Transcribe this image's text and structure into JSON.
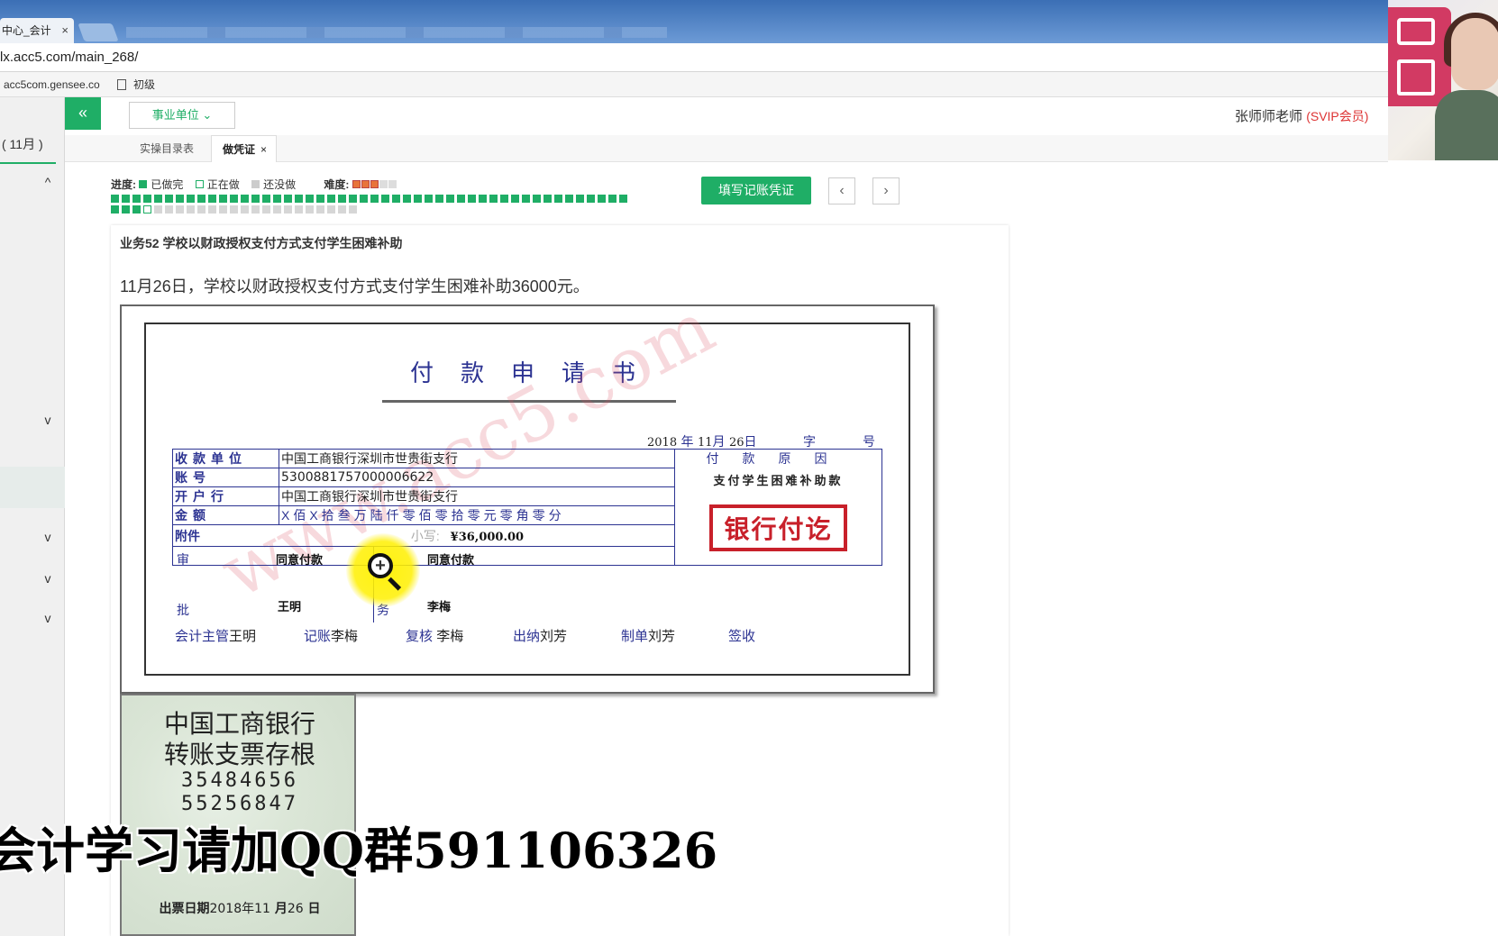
{
  "browser": {
    "tab_title": "中心_会计",
    "tab_close": "×",
    "url": "lx.acc5.com/main_268/",
    "bookmarks": [
      "acc5com.gensee.co",
      "初级"
    ]
  },
  "sidebar": {
    "month": "( 11月 )",
    "chevrons": [
      "^",
      "v",
      "v",
      "v",
      "v"
    ]
  },
  "toolbar": {
    "collapse": "«",
    "unit_select": "事业单位",
    "unit_chevron": "⌄",
    "teacher": "张师师老师",
    "svip": "(SVIP会员)"
  },
  "subtabs": {
    "catalog": "实操目录表",
    "voucher": "做凭证",
    "voucher_close": "×"
  },
  "progress": {
    "label": "进度:",
    "done": "已做完",
    "doing": "正在做",
    "todo": "还没做",
    "difficulty_label": "难度:",
    "difficulty": 3,
    "difficulty_max": 5,
    "total_items": 71,
    "completed_items": 51,
    "current_item": 52
  },
  "actions": {
    "fill_voucher": "填写记账凭证",
    "prev": "‹",
    "next": "›"
  },
  "task": {
    "title": "业务52 学校以财政授权支付方式支付学生困难补助",
    "description": "11月26日，学校以财政授权支付方式支付学生困难补助36000元。"
  },
  "form": {
    "title": "付款申请书",
    "watermark": "www.acc5.com",
    "date": {
      "year": "2018",
      "year_unit": "年",
      "month": "11",
      "month_unit": "月",
      "day": "26",
      "day_unit": "日",
      "zi": "字",
      "hao": "号"
    },
    "rows": {
      "payee_label": "收款单位",
      "payee": "中国工商银行深圳市世贵街支行",
      "account_label": "账号",
      "account": "5300881757000006622",
      "bank_label": "开户行",
      "bank": "中国工商银行深圳市世贵街支行",
      "amount_label": "金额",
      "amount_words": "X佰X拾叁万陆仟零佰零拾零元零角零分",
      "attachment_label": "附件",
      "small_label": "小写:",
      "amount_small": "¥36,000.00",
      "reason_header": "付款原因",
      "reason": "支付学生困难补助款",
      "stamp": "银行付讫",
      "approval_label_top": "审",
      "approval_label_bottom": "批",
      "approval_text_1": "同意付款",
      "approval_sign_1": "王明",
      "business_label": "务",
      "approval_text_2": "同意付款",
      "approval_sign_2": "李梅"
    },
    "footer": {
      "supervisor_label": "会计主管",
      "supervisor": "王明",
      "bookkeeper_label": "记账",
      "bookkeeper": "李梅",
      "reviewer_label": "复核",
      "reviewer": "李梅",
      "cashier_label": "出纳",
      "cashier": "刘芳",
      "maker_label": "制单",
      "maker": "刘芳",
      "receiver_label": "签收"
    }
  },
  "check_stub": {
    "bank": "中国工商银行",
    "title": "转账支票存根",
    "number1": "35484656",
    "number2": "55256847",
    "date_label": "出票日期",
    "date_year": "2018",
    "date_year_unit": "年",
    "date_month": "11",
    "date_month_unit": "月",
    "date_day": "26",
    "date_day_unit": "日"
  },
  "overlay": {
    "caption": "会计学习请加QQ群591106326"
  },
  "colors": {
    "accent": "#1fae66",
    "form_ink": "#2c3392",
    "stamp_red": "#c8202a"
  }
}
